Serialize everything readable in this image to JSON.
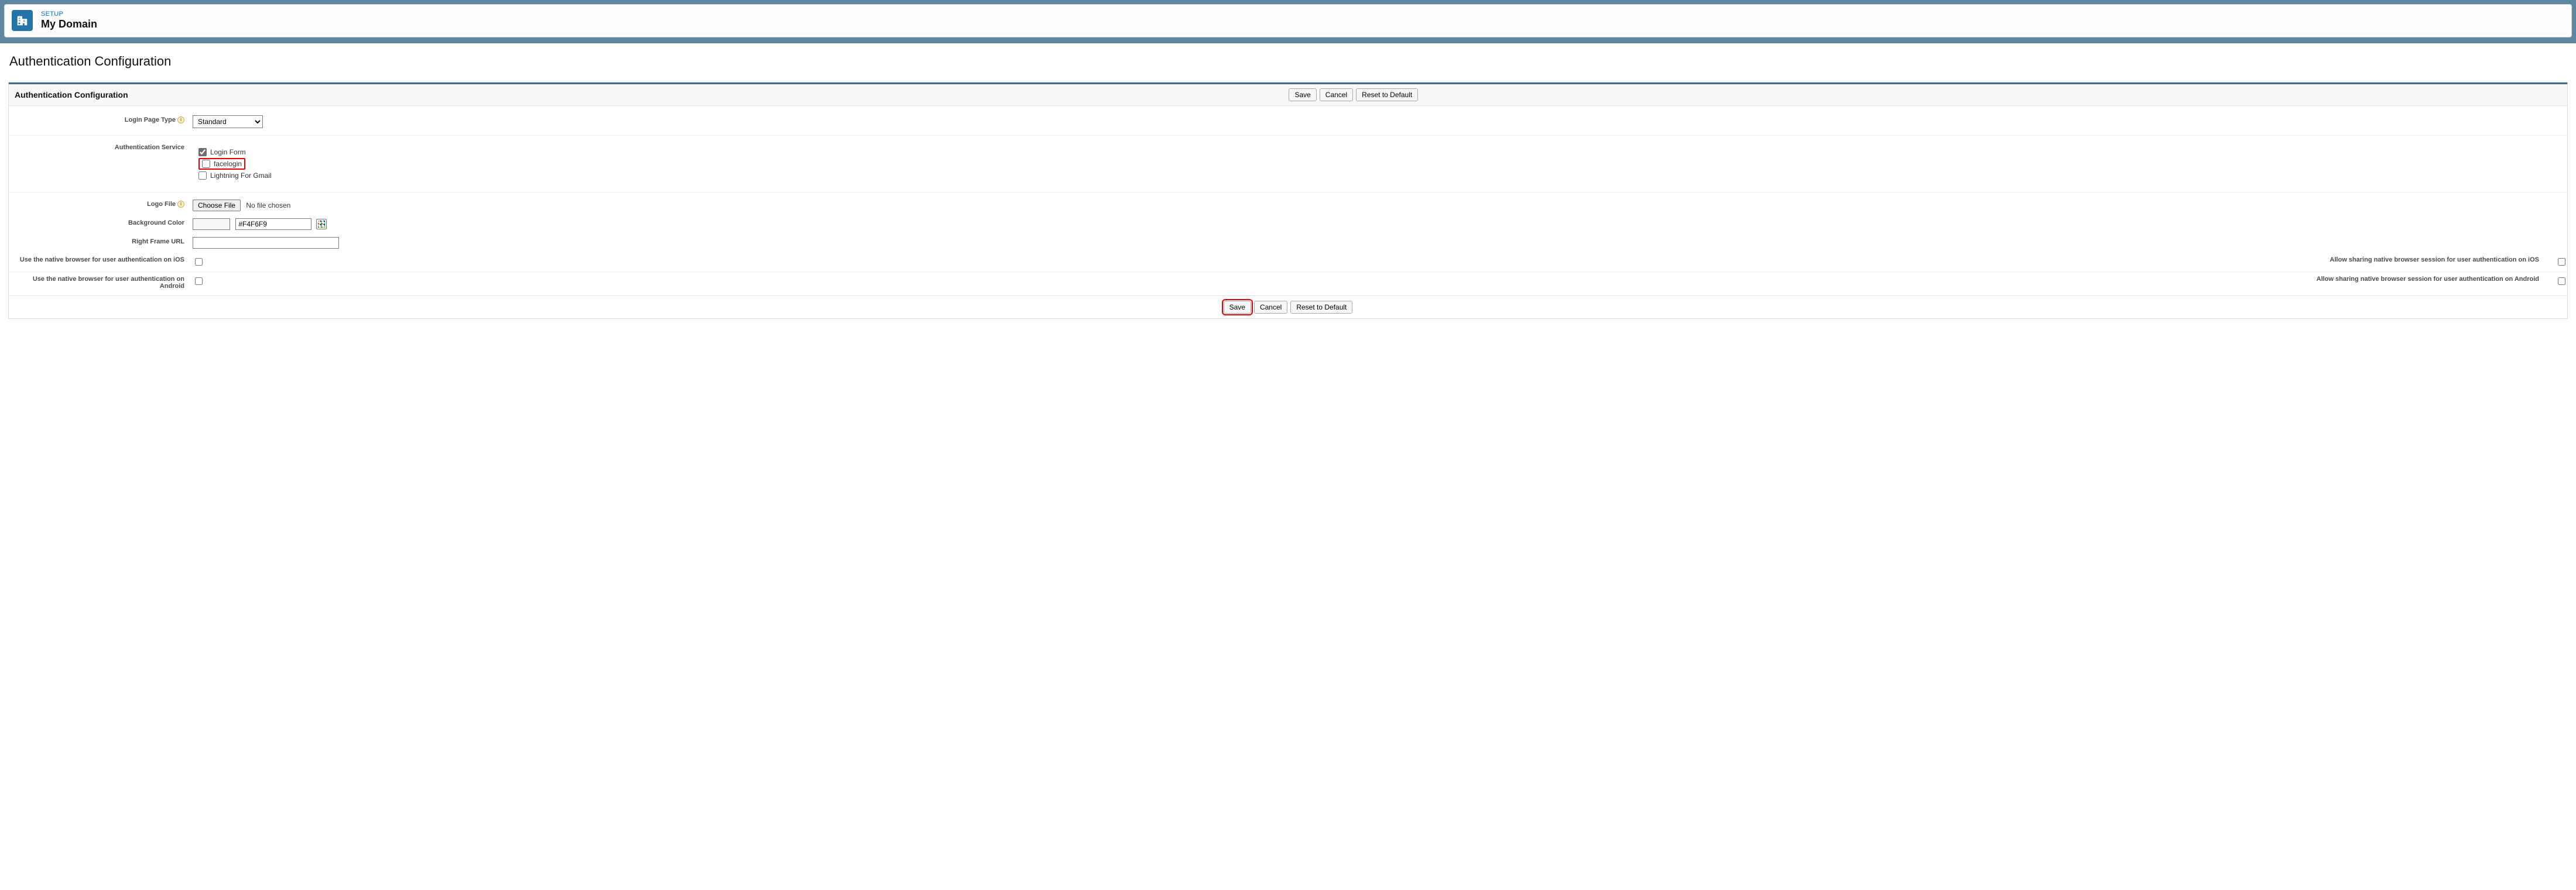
{
  "header": {
    "breadcrumb": "SETUP",
    "title": "My Domain",
    "icon": "building-icon"
  },
  "page": {
    "heading": "Authentication Configuration"
  },
  "panel": {
    "title": "Authentication Configuration"
  },
  "buttons": {
    "save": "Save",
    "cancel": "Cancel",
    "reset": "Reset to Default"
  },
  "form": {
    "login_page_type": {
      "label": "Login Page Type",
      "selected": "Standard",
      "options": [
        "Standard"
      ]
    },
    "auth_service": {
      "label": "Authentication Service",
      "items": [
        {
          "label": "Login Form",
          "checked": true,
          "highlight": false
        },
        {
          "label": "facelogin",
          "checked": false,
          "highlight": true
        },
        {
          "label": "Lightning For Gmail",
          "checked": false,
          "highlight": false
        }
      ]
    },
    "logo_file": {
      "label": "Logo File",
      "button": "Choose File",
      "status": "No file chosen"
    },
    "bg_color": {
      "label": "Background Color",
      "value": "#F4F6F9"
    },
    "right_frame": {
      "label": "Right Frame URL",
      "value": ""
    },
    "native_ios": {
      "label": "Use the native browser for user authentication on iOS",
      "checked": false
    },
    "share_ios": {
      "label": "Allow sharing native browser session for user authentication on iOS",
      "checked": false
    },
    "native_android": {
      "label": "Use the native browser for user authentication on Android",
      "checked": false
    },
    "share_android": {
      "label": "Allow sharing native browser session for user authentication on Android",
      "checked": false
    }
  }
}
